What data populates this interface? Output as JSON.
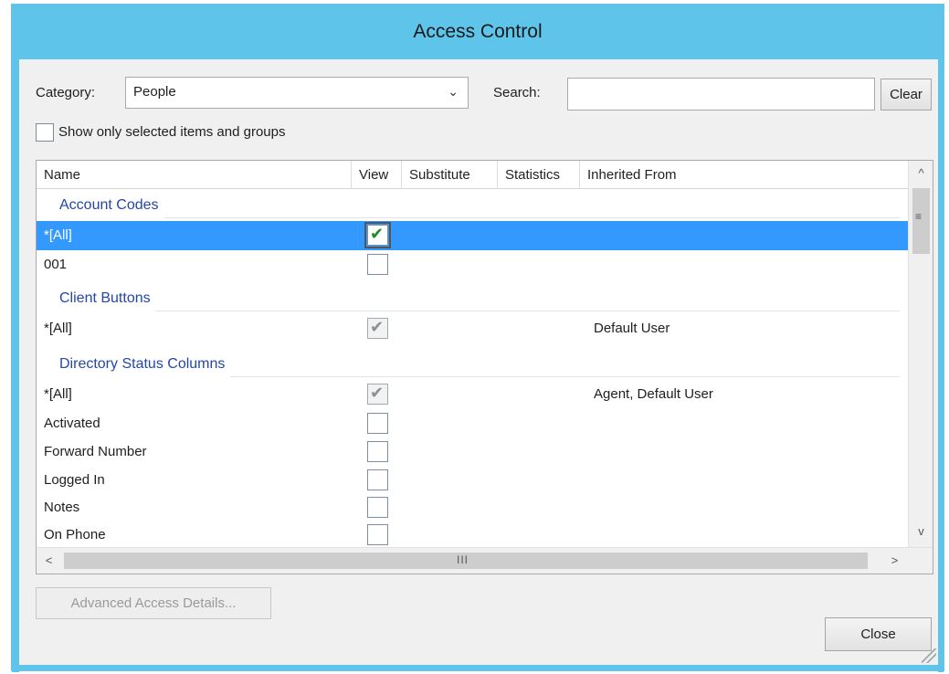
{
  "window": {
    "title": "Access Control"
  },
  "filters": {
    "category_label": "Category:",
    "category_value": "People",
    "search_label": "Search:",
    "search_value": "",
    "clear_label": "Clear",
    "show_selected_label": "Show only selected items and groups",
    "show_selected_checked": false
  },
  "grid": {
    "columns": [
      "Name",
      "View",
      "Substitute",
      "Statistics",
      "Inherited From"
    ],
    "groups": [
      {
        "label": "Account Codes"
      },
      {
        "label": "Client Buttons"
      },
      {
        "label": "Directory Status Columns"
      }
    ],
    "rows": [
      {
        "name": "*[All]",
        "view": "checked",
        "inherited_from": "",
        "selected": true
      },
      {
        "name": "001",
        "view": "unchecked",
        "inherited_from": ""
      },
      {
        "name": "*[All]",
        "view": "inherited",
        "inherited_from": "Default User"
      },
      {
        "name": "*[All]",
        "view": "inherited",
        "inherited_from": "Agent, Default User"
      },
      {
        "name": "Activated",
        "view": "unchecked",
        "inherited_from": ""
      },
      {
        "name": "Forward Number",
        "view": "unchecked",
        "inherited_from": ""
      },
      {
        "name": "Logged In",
        "view": "unchecked",
        "inherited_from": ""
      },
      {
        "name": "Notes",
        "view": "unchecked",
        "inherited_from": ""
      },
      {
        "name": "On Phone",
        "view": "unchecked",
        "inherited_from": ""
      }
    ],
    "scroll_grip": "III",
    "vscroll_grip": "≡"
  },
  "footer": {
    "advanced_label": "Advanced Access Details...",
    "close_label": "Close"
  },
  "icons": {
    "check": "✔",
    "chevron_down": "⌄",
    "arrow_up": "^",
    "arrow_down": "v",
    "arrow_left": "<",
    "arrow_right": ">"
  },
  "colors": {
    "titlebar": "#5ec4ea",
    "selection": "#3399ff",
    "group_label": "#2347a8"
  }
}
